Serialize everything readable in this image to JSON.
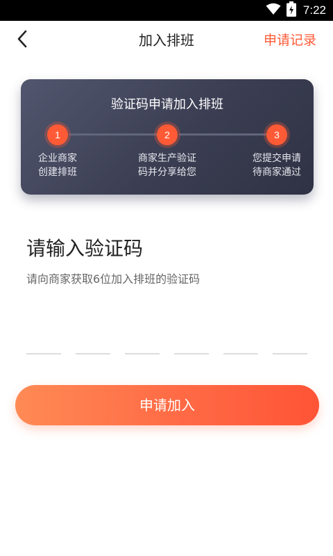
{
  "status_bar": {
    "time": "7:22",
    "icons": [
      "wifi-icon",
      "battery-icon"
    ]
  },
  "header": {
    "title": "加入排班",
    "back_icon": "chevron-left-icon",
    "records_label": "申请记录"
  },
  "steps_card": {
    "title": "验证码申请加入排班",
    "steps": [
      {
        "number": "1",
        "line1": "企业商家",
        "line2": "创建排班"
      },
      {
        "number": "2",
        "line1": "商家生产验证",
        "line2": "码并分享给您"
      },
      {
        "number": "3",
        "line1": "您提交申请",
        "line2": "待商家通过"
      }
    ]
  },
  "code_entry": {
    "heading": "请输入验证码",
    "hint": "请向商家获取6位加入排班的验证码",
    "digits": [
      "",
      "",
      "",
      "",
      "",
      ""
    ]
  },
  "apply_button": {
    "label": "申请加入"
  },
  "colors": {
    "accent": "#ff5a36",
    "card_dark": "#3b3e52",
    "text_dark": "#222222",
    "text_muted": "#666666"
  }
}
